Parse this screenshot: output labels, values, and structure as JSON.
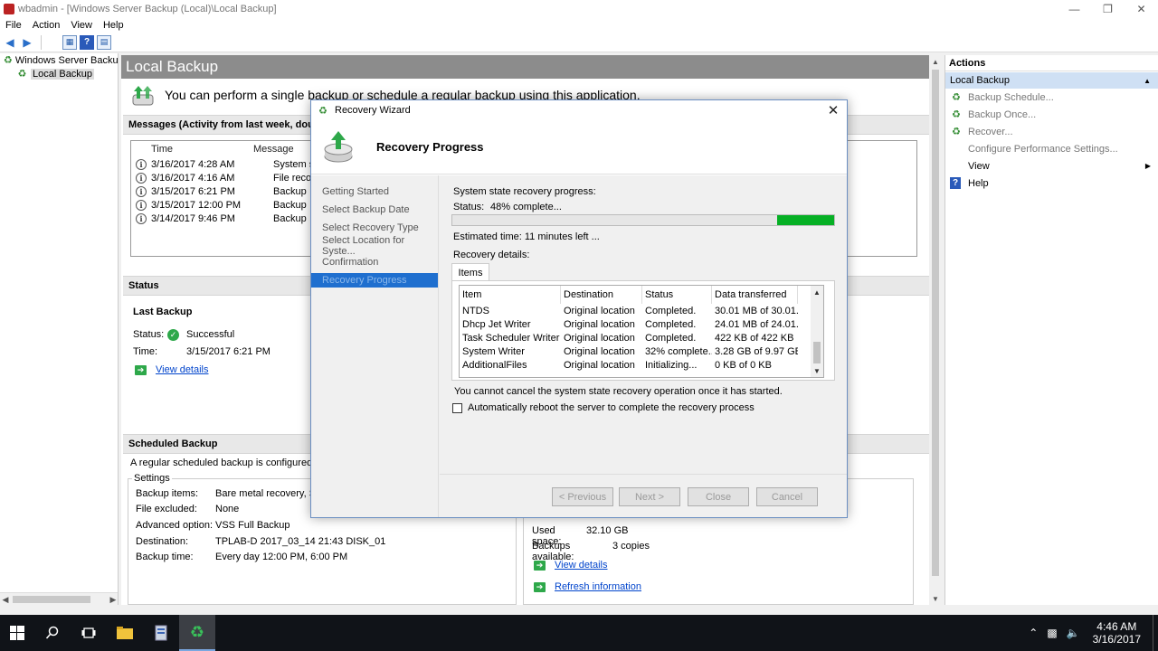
{
  "window": {
    "title": "wbadmin - [Windows Server Backup (Local)\\Local Backup]",
    "controls": [
      "—",
      "❐",
      "✕"
    ]
  },
  "menu": [
    "File",
    "Action",
    "View",
    "Help"
  ],
  "tree": {
    "root": "Windows Server Backup (L",
    "child": "Local Backup"
  },
  "center": {
    "header": "Local Backup",
    "intro": "You can perform a single backup or schedule a regular backup using this application.",
    "messages_title": "Messages (Activity from last week, double cl",
    "messages_cols": [
      "Time",
      "Message"
    ],
    "messages": [
      {
        "time": "3/16/2017 4:28 AM",
        "message": "System st"
      },
      {
        "time": "3/16/2017 4:16 AM",
        "message": "File recov"
      },
      {
        "time": "3/15/2017 6:21 PM",
        "message": "Backup"
      },
      {
        "time": "3/15/2017 12:00 PM",
        "message": "Backup"
      },
      {
        "time": "3/14/2017 9:46 PM",
        "message": "Backup"
      }
    ],
    "status_title": "Status",
    "last_backup": {
      "title": "Last Backup",
      "status_label": "Status:",
      "status_value": "Successful",
      "time_label": "Time:",
      "time_value": "3/15/2017 6:21 PM",
      "view_details": "View details"
    },
    "scheduled_title": "Scheduled Backup",
    "scheduled_note": "A regular scheduled backup is configured for th",
    "settings_label": "Settings",
    "settings": [
      {
        "label": "Backup items:",
        "value": "Bare metal recovery, Syst"
      },
      {
        "label": "File excluded:",
        "value": "None"
      },
      {
        "label": "Advanced option:",
        "value": "VSS Full Backup"
      },
      {
        "label": "Destination:",
        "value": "TPLAB-D 2017_03_14 21:43 DISK_01"
      },
      {
        "label": "Backup time:",
        "value": "Every day 12:00 PM, 6:00 PM"
      }
    ],
    "destination_info": [
      {
        "label": "Used space:",
        "value": "32.10 GB"
      },
      {
        "label": "Backups available:",
        "value": "3 copies"
      }
    ],
    "dest_view_details": "View details",
    "refresh_info": "Refresh information"
  },
  "actions": {
    "header": "Actions",
    "group": "Local Backup",
    "items": [
      {
        "label": "Backup Schedule...",
        "icon": "backup-schedule-icon"
      },
      {
        "label": "Backup Once...",
        "icon": "backup-once-icon"
      },
      {
        "label": "Recover...",
        "icon": "recover-icon"
      },
      {
        "label": "Configure Performance Settings...",
        "icon": ""
      },
      {
        "label": "View",
        "icon": ""
      },
      {
        "label": "Help",
        "icon": "help-icon"
      }
    ]
  },
  "dialog": {
    "title": "Recovery Wizard",
    "heading": "Recovery Progress",
    "nav": [
      "Getting Started",
      "Select Backup Date",
      "Select Recovery Type",
      "Select Location for Syste...",
      "Confirmation",
      "Recovery Progress"
    ],
    "progress_label": "System state recovery progress:",
    "status_label": "Status:",
    "status_value": "48% complete...",
    "progress_percent": 48,
    "estimated": "Estimated time: 11 minutes left ...",
    "details_label": "Recovery details:",
    "tab": "Items",
    "columns": [
      "Item",
      "Destination",
      "Status",
      "Data transferred"
    ],
    "rows": [
      {
        "item": "NTDS",
        "destination": "Original location",
        "status": "Completed.",
        "data": "30.01 MB of 30.01..."
      },
      {
        "item": "Dhcp Jet Writer",
        "destination": "Original location",
        "status": "Completed.",
        "data": "24.01 MB of 24.01..."
      },
      {
        "item": "Task Scheduler Writer",
        "destination": "Original location",
        "status": "Completed.",
        "data": "422 KB of 422 KB"
      },
      {
        "item": "System Writer",
        "destination": "Original location",
        "status": "32% complete...",
        "data": "3.28 GB of 9.97 GB"
      },
      {
        "item": "AdditionalFiles",
        "destination": "Original location",
        "status": "Initializing...",
        "data": "0 KB of 0 KB"
      }
    ],
    "cancel_note": "You cannot cancel the system state recovery operation once it has started.",
    "auto_reboot": "Automatically reboot the server to complete the recovery process",
    "buttons": {
      "previous": "< Previous",
      "next": "Next >",
      "close": "Close",
      "cancel": "Cancel"
    }
  },
  "taskbar": {
    "time": "4:46 AM",
    "date": "3/16/2017"
  },
  "colors": {
    "accent": "#1f6fcf",
    "progress": "#06b025",
    "header_gray": "#8c8c8c"
  }
}
